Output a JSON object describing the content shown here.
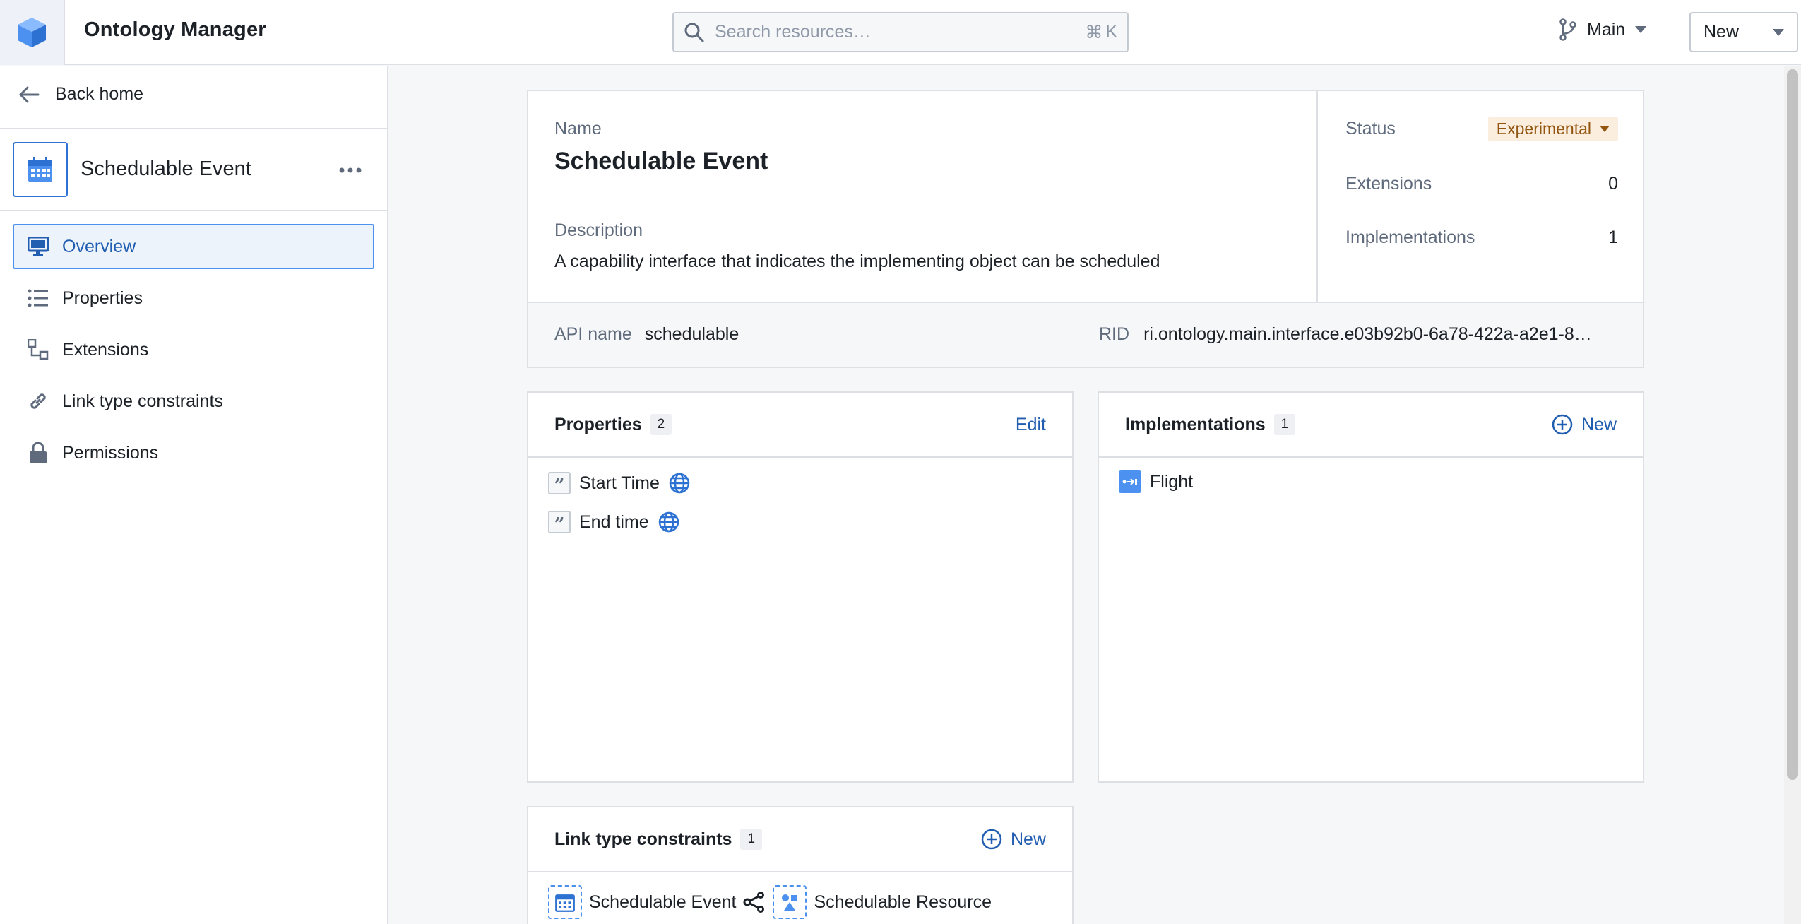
{
  "app": {
    "title": "Ontology Manager"
  },
  "search": {
    "placeholder": "Search resources…",
    "shortcut_key": "K"
  },
  "branch": {
    "label": "Main"
  },
  "new_button": {
    "label": "New"
  },
  "sidebar": {
    "back_label": "Back home",
    "entity_name": "Schedulable Event",
    "nav": [
      {
        "label": "Overview",
        "icon": "desktop-icon",
        "active": true
      },
      {
        "label": "Properties",
        "icon": "list-icon",
        "active": false
      },
      {
        "label": "Extensions",
        "icon": "extensions-icon",
        "active": false
      },
      {
        "label": "Link type constraints",
        "icon": "link-icon",
        "active": false
      },
      {
        "label": "Permissions",
        "icon": "lock-icon",
        "active": false
      }
    ]
  },
  "header": {
    "name_label": "Name",
    "name": "Schedulable Event",
    "description_label": "Description",
    "description": "A capability interface that indicates the implementing object can be scheduled",
    "status_label": "Status",
    "status": "Experimental",
    "extensions_label": "Extensions",
    "extensions_count": "0",
    "implementations_label": "Implementations",
    "implementations_count": "1",
    "api_name_label": "API name",
    "api_name": "schedulable",
    "rid_label": "RID",
    "rid": "ri.ontology.main.interface.e03b92b0-6a78-422a-a2e1-8…"
  },
  "properties_panel": {
    "title": "Properties",
    "count": "2",
    "action": "Edit",
    "items": [
      {
        "name": "Start Time"
      },
      {
        "name": "End time"
      }
    ]
  },
  "implementations_panel": {
    "title": "Implementations",
    "count": "1",
    "action": "New",
    "items": [
      {
        "name": "Flight"
      }
    ]
  },
  "link_panel": {
    "title": "Link type constraints",
    "count": "1",
    "action": "New",
    "from": "Schedulable Event",
    "to": "Schedulable Resource"
  },
  "colors": {
    "accent": "#2d72d2",
    "link": "#215db0",
    "status_bg": "#fbeedf",
    "status_fg": "#935610"
  }
}
